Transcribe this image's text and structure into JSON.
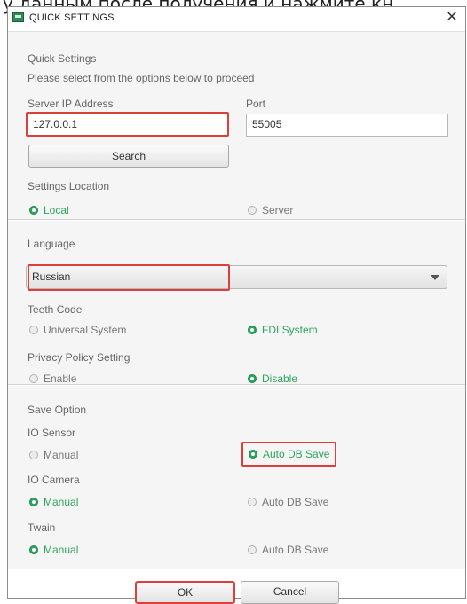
{
  "background_text": "у данным после получения и нажмите кн",
  "window": {
    "title": "QUICK SETTINGS",
    "close": "✕"
  },
  "quick": {
    "heading": "Quick Settings",
    "subtitle": "Please select from the options below to proceed",
    "server_ip_label": "Server IP Address",
    "server_ip_value": "127.0.0.1",
    "port_label": "Port",
    "port_value": "55005",
    "search_label": "Search",
    "location_label": "Settings Location",
    "location_local": "Local",
    "location_server": "Server"
  },
  "lang": {
    "label": "Language",
    "selected": "Russian",
    "teeth_label": "Teeth Code",
    "teeth_universal": "Universal System",
    "teeth_fdi": "FDI System",
    "privacy_label": "Privacy Policy Setting",
    "privacy_enable": "Enable",
    "privacy_disable": "Disable"
  },
  "save": {
    "label": "Save Option",
    "sensor_label": "IO Sensor",
    "sensor_manual": "Manual",
    "sensor_auto": "Auto DB Save",
    "camera_label": "IO Camera",
    "camera_manual": "Manual",
    "camera_auto": "Auto DB Save",
    "twain_label": "Twain",
    "twain_manual": "Manual",
    "twain_auto": "Auto DB Save"
  },
  "footer": {
    "ok_label": "OK",
    "cancel_label": "Cancel"
  },
  "colors": {
    "accent_green": "#2ca55c",
    "highlight_red": "#d9413a"
  }
}
